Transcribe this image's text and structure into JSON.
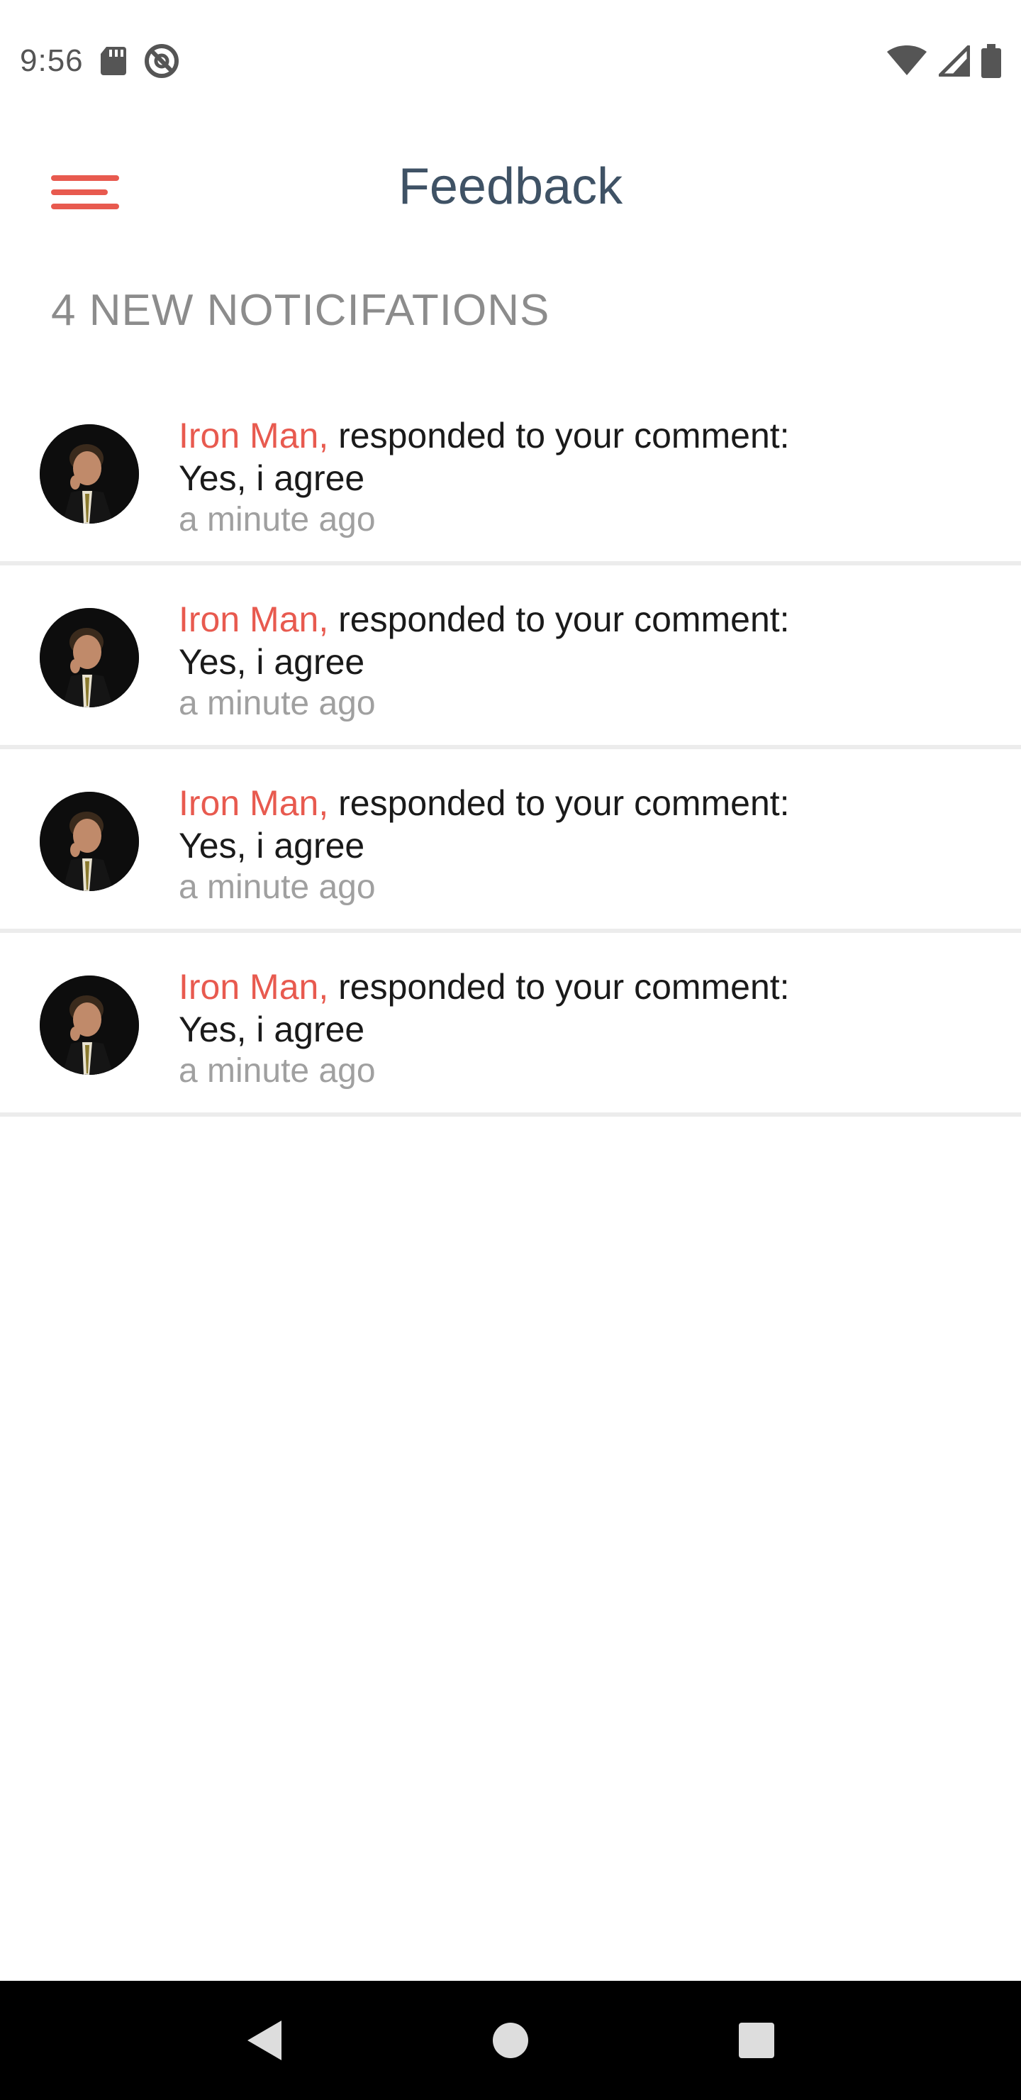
{
  "status_bar": {
    "time": "9:56",
    "left_icons": [
      "sd-card-icon",
      "do-not-disturb-icon"
    ],
    "right_icons": [
      "wifi-icon",
      "signal-icon",
      "battery-icon"
    ]
  },
  "app_bar": {
    "menu_icon": "hamburger-menu-icon",
    "title": "Feedback"
  },
  "notifications": {
    "header": "4 NEW NOTICIFATIONS",
    "items": [
      {
        "author": "Iron Man,",
        "action": "responded to your comment:",
        "comment": "Yes, i agree",
        "time": "a minute ago"
      },
      {
        "author": "Iron Man,",
        "action": "responded to your comment:",
        "comment": "Yes, i agree",
        "time": "a minute ago"
      },
      {
        "author": "Iron Man,",
        "action": "responded to your comment:",
        "comment": "Yes, i agree",
        "time": "a minute ago"
      },
      {
        "author": "Iron Man,",
        "action": "responded to your comment:",
        "comment": "Yes, i agree",
        "time": "a minute ago"
      }
    ]
  },
  "nav_bar": {
    "icons": [
      "back-icon",
      "home-icon",
      "recents-icon"
    ]
  },
  "colors": {
    "accent": "#e85a4f",
    "title": "#3f5265",
    "muted": "#8c8c8c",
    "divider": "#ececec"
  }
}
